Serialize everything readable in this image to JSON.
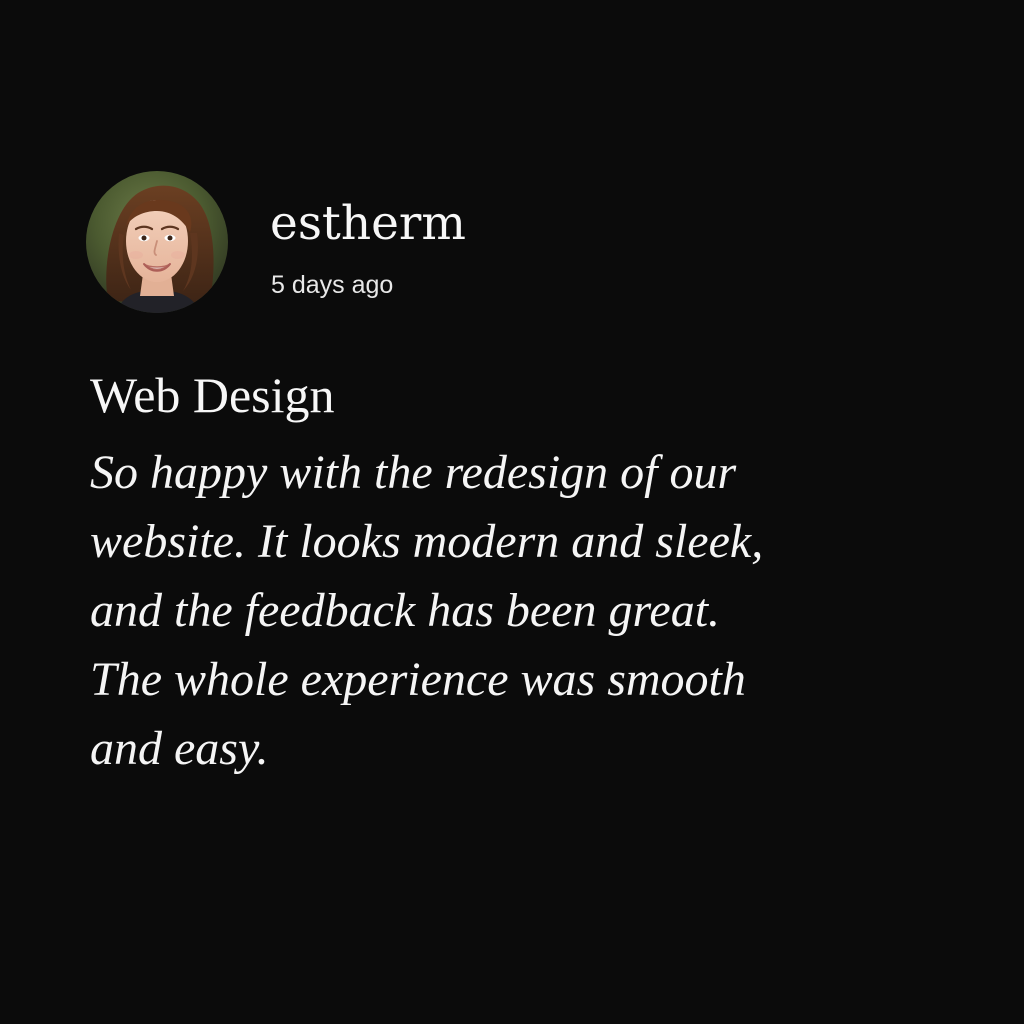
{
  "post": {
    "author": {
      "username": "estherm",
      "avatar_icon": "user-avatar-photo"
    },
    "timestamp": "5 days ago",
    "title": "Web Design",
    "body_lines": [
      "So happy with the redesign of our",
      "website. It looks modern and sleek,",
      "and the feedback has been great.",
      "The whole experience was smooth",
      "and easy."
    ]
  },
  "colors": {
    "background": "#0b0b0b",
    "text": "#f5f5f5"
  }
}
